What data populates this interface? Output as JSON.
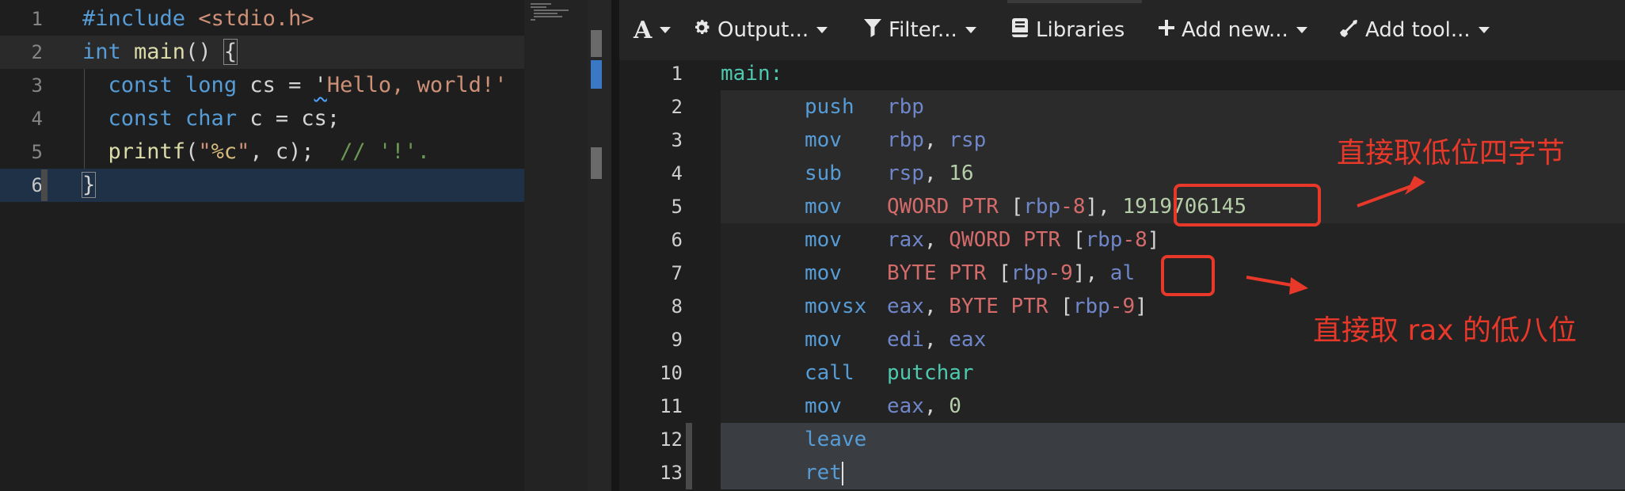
{
  "source": {
    "line_numbers": [
      "1",
      "2",
      "3",
      "4",
      "5",
      "6"
    ],
    "lines": [
      [
        [
          "t-dir",
          "#include "
        ],
        [
          "t-inc",
          "<stdio.h>"
        ]
      ],
      [
        [
          "t-kw",
          "int "
        ],
        [
          "t-fn",
          "main"
        ],
        [
          "",
          "() "
        ],
        [
          "brace",
          "{"
        ]
      ],
      [
        [
          "",
          "  "
        ],
        [
          "t-kw",
          "const long "
        ],
        [
          "",
          "cs = "
        ],
        [
          "squig",
          "'"
        ],
        [
          "t-str",
          "Hello, world!'"
        ]
      ],
      [
        [
          "",
          "  "
        ],
        [
          "t-kw",
          "const char "
        ],
        [
          "",
          "c = cs;"
        ]
      ],
      [
        [
          "",
          "  "
        ],
        [
          "t-fn",
          "printf"
        ],
        [
          "",
          "("
        ],
        [
          "t-str",
          "\""
        ],
        [
          "t-ch",
          "%c"
        ],
        [
          "t-str",
          "\""
        ],
        [
          "",
          ", c);  "
        ],
        [
          "t-cm",
          "// '!'."
        ]
      ],
      [
        [
          "brace",
          "}"
        ]
      ]
    ]
  },
  "toolbar": {
    "font_label": "A",
    "output_label": "Output...",
    "filter_label": "Filter...",
    "libraries_label": "Libraries",
    "add_new_label": "Add new...",
    "add_tool_label": "Add tool..."
  },
  "assembly": {
    "line_numbers": [
      "1",
      "2",
      "3",
      "4",
      "5",
      "6",
      "7",
      "8",
      "9",
      "10",
      "11",
      "12",
      "13"
    ],
    "lines": [
      {
        "label": "main:",
        "op": "",
        "args": []
      },
      {
        "op": "push",
        "args": [
          [
            "a-reg",
            "rbp"
          ]
        ]
      },
      {
        "op": "mov",
        "args": [
          [
            "a-reg",
            "rbp"
          ],
          [
            "a-punct",
            ", "
          ],
          [
            "a-reg",
            "rsp"
          ]
        ]
      },
      {
        "op": "sub",
        "args": [
          [
            "a-reg",
            "rsp"
          ],
          [
            "a-punct",
            ", "
          ],
          [
            "a-num",
            "16"
          ]
        ]
      },
      {
        "op": "mov",
        "args": [
          [
            "a-size",
            "QWORD PTR "
          ],
          [
            "a-punct",
            "["
          ],
          [
            "a-reg",
            "rbp"
          ],
          [
            "a-size",
            "-8"
          ],
          [
            "a-punct",
            "], "
          ],
          [
            "a-num",
            "1919706145"
          ]
        ]
      },
      {
        "op": "mov",
        "args": [
          [
            "a-reg",
            "rax"
          ],
          [
            "a-punct",
            ", "
          ],
          [
            "a-size",
            "QWORD PTR "
          ],
          [
            "a-punct",
            "["
          ],
          [
            "a-reg",
            "rbp"
          ],
          [
            "a-size",
            "-8"
          ],
          [
            "a-punct",
            "]"
          ]
        ]
      },
      {
        "op": "mov",
        "args": [
          [
            "a-size",
            "BYTE PTR "
          ],
          [
            "a-punct",
            "["
          ],
          [
            "a-reg",
            "rbp"
          ],
          [
            "a-size",
            "-9"
          ],
          [
            "a-punct",
            "], "
          ],
          [
            "a-reg",
            "al"
          ]
        ]
      },
      {
        "op": "movsx",
        "args": [
          [
            "a-reg",
            "eax"
          ],
          [
            "a-punct",
            ", "
          ],
          [
            "a-size",
            "BYTE PTR "
          ],
          [
            "a-punct",
            "["
          ],
          [
            "a-reg",
            "rbp"
          ],
          [
            "a-size",
            "-9"
          ],
          [
            "a-punct",
            "]"
          ]
        ]
      },
      {
        "op": "mov",
        "args": [
          [
            "a-reg",
            "edi"
          ],
          [
            "a-punct",
            ", "
          ],
          [
            "a-reg",
            "eax"
          ]
        ]
      },
      {
        "op": "call",
        "args": [
          [
            "a-call",
            "putchar"
          ]
        ]
      },
      {
        "op": "mov",
        "args": [
          [
            "a-reg",
            "eax"
          ],
          [
            "a-punct",
            ", "
          ],
          [
            "a-num",
            "0"
          ]
        ]
      },
      {
        "op": "leave",
        "args": []
      },
      {
        "op": "ret",
        "args": []
      }
    ]
  },
  "annotations": {
    "low_four_bytes": "直接取低位四字节",
    "low_eight_bits": "直接取 rax 的低八位"
  },
  "colors": {
    "annotation": "#e8382a",
    "keyword": "#569cd6",
    "string": "#ce9178",
    "label": "#4ec9b0"
  }
}
